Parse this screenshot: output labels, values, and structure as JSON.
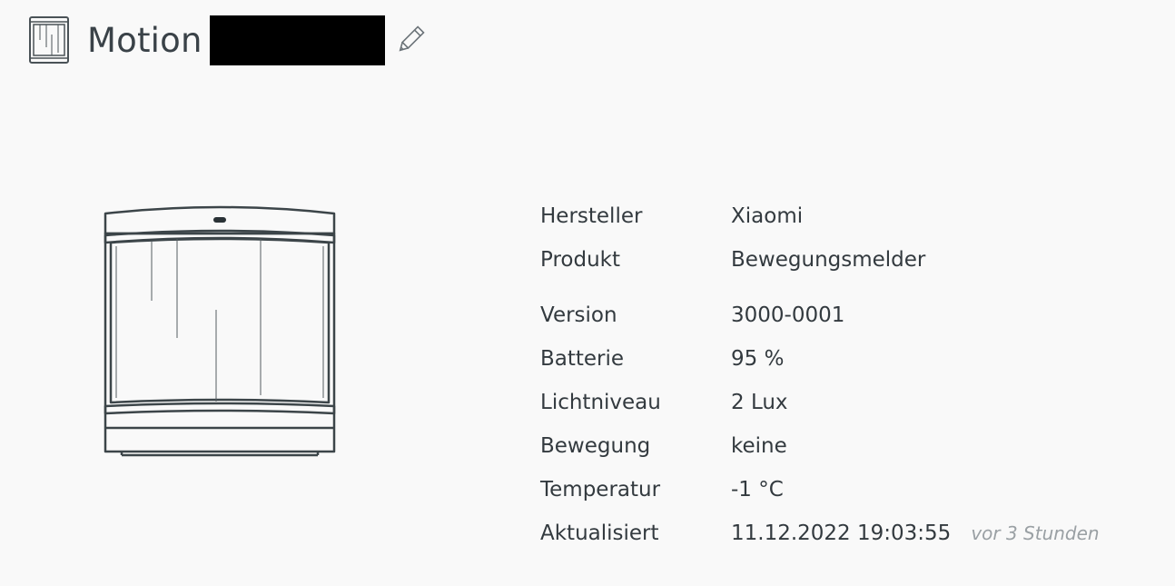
{
  "header": {
    "title": "Motion",
    "icon": "motion-sensor-icon",
    "edit_icon": "pencil-icon"
  },
  "device": {
    "image": "motion-sensor-illustration"
  },
  "info": {
    "hersteller_label": "Hersteller",
    "hersteller_value": "Xiaomi",
    "produkt_label": "Produkt",
    "produkt_value": "Bewegungsmelder",
    "version_label": "Version",
    "version_value": "3000-0001",
    "batterie_label": "Batterie",
    "batterie_value": "95 %",
    "lichtniveau_label": "Lichtniveau",
    "lichtniveau_value": "2 Lux",
    "bewegung_label": "Bewegung",
    "bewegung_value": "keine",
    "temperatur_label": "Temperatur",
    "temperatur_value": "-1 °C",
    "aktualisiert_label": "Aktualisiert",
    "aktualisiert_value": "11.12.2022 19:03:55",
    "aktualisiert_relative": "vor 3 Stunden"
  },
  "colors": {
    "background": "#f9f9f9",
    "text": "#333a3f",
    "muted": "#9aa0a4",
    "redaction": "#000000"
  }
}
